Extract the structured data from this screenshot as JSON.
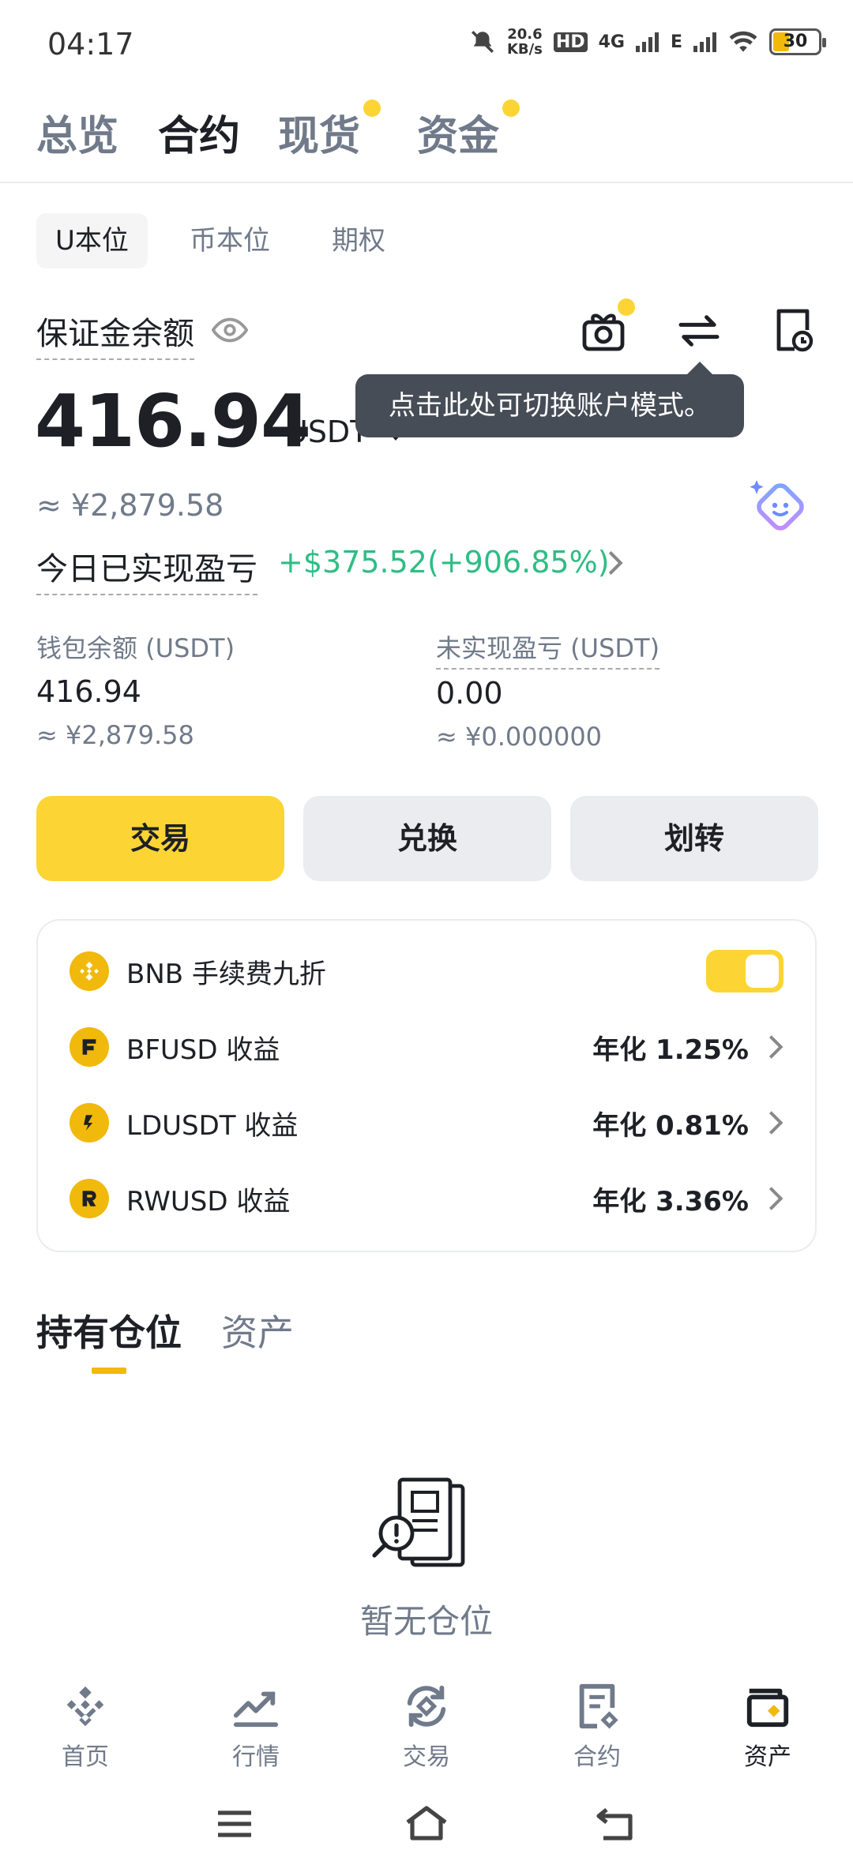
{
  "status": {
    "time": "04:17",
    "net_speed_value": "20.6",
    "net_speed_unit": "KB/s",
    "signal1": "HD",
    "signal2": "4G",
    "signal3": "E",
    "battery": "30"
  },
  "top_tabs": [
    {
      "label": "总览",
      "active": false
    },
    {
      "label": "合约",
      "active": true
    },
    {
      "label": "现货",
      "active": false,
      "dot": true
    },
    {
      "label": "资金",
      "active": false,
      "dot": true
    }
  ],
  "sub_tabs": [
    {
      "label": "U本位",
      "active": true
    },
    {
      "label": "币本位",
      "active": false
    },
    {
      "label": "期权",
      "active": false
    }
  ],
  "balance": {
    "label": "保证金余额",
    "amount": "416.94",
    "unit": "USDT",
    "cny": "≈ ¥2,879.58",
    "pnl_label": "今日已实现盈亏",
    "pnl_value": "+$375.52(+906.85%)"
  },
  "tooltip": "点击此处可切换账户模式。",
  "stats": {
    "wallet_label": "钱包余额 (USDT)",
    "wallet_value": "416.94",
    "wallet_cny": "≈ ¥2,879.58",
    "unrealized_label": "未实现盈亏 (USDT)",
    "unrealized_value": "0.00",
    "unrealized_cny": "≈ ¥0.000000"
  },
  "actions": {
    "trade": "交易",
    "convert": "兑换",
    "transfer": "划转"
  },
  "card": {
    "bnb_label": "BNB 手续费九折",
    "bnb_toggle_on": true,
    "rows": [
      {
        "label": "BFUSD 收益",
        "rate": "年化 1.25%"
      },
      {
        "label": "LDUSDT 收益",
        "rate": "年化 0.81%"
      },
      {
        "label": "RWUSD 收益",
        "rate": "年化 3.36%"
      }
    ]
  },
  "positions": {
    "tab_positions": "持有仓位",
    "tab_assets": "资产",
    "empty": "暂无仓位"
  },
  "bottom_nav": [
    {
      "label": "首页",
      "icon": "home-icon"
    },
    {
      "label": "行情",
      "icon": "markets-icon"
    },
    {
      "label": "交易",
      "icon": "trade-icon"
    },
    {
      "label": "合约",
      "icon": "futures-icon"
    },
    {
      "label": "资产",
      "icon": "wallet-icon",
      "active": true
    }
  ],
  "colors": {
    "accent": "#fcd535",
    "positive": "#2ebd85",
    "muted": "#707a8a"
  }
}
